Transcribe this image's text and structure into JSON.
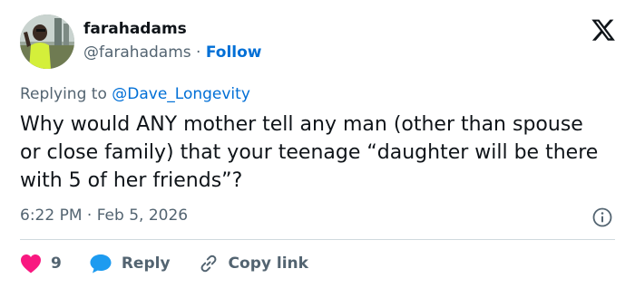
{
  "user": {
    "display_name": "farahadams",
    "handle": "@farahadams",
    "separator": "·",
    "follow_label": "Follow"
  },
  "reply_context": {
    "prefix": "Replying to ",
    "mention": "@Dave_Longevity"
  },
  "tweet": {
    "text": "Why would ANY mother tell any man (other than spouse or close family) that your teenage “daughter will be there with 5 of her friends”?",
    "timestamp": "6:22 PM · Feb 5, 2026"
  },
  "actions": {
    "like_count": "9",
    "reply_label": "Reply",
    "copy_link_label": "Copy link"
  },
  "colors": {
    "link_blue": "#006fd6",
    "like_pink": "#f91880",
    "reply_blue": "#1d9bf0",
    "secondary_text": "#536471"
  },
  "icons": [
    "x-logo-icon",
    "info-icon",
    "heart-icon",
    "reply-bubble-icon",
    "link-icon"
  ]
}
